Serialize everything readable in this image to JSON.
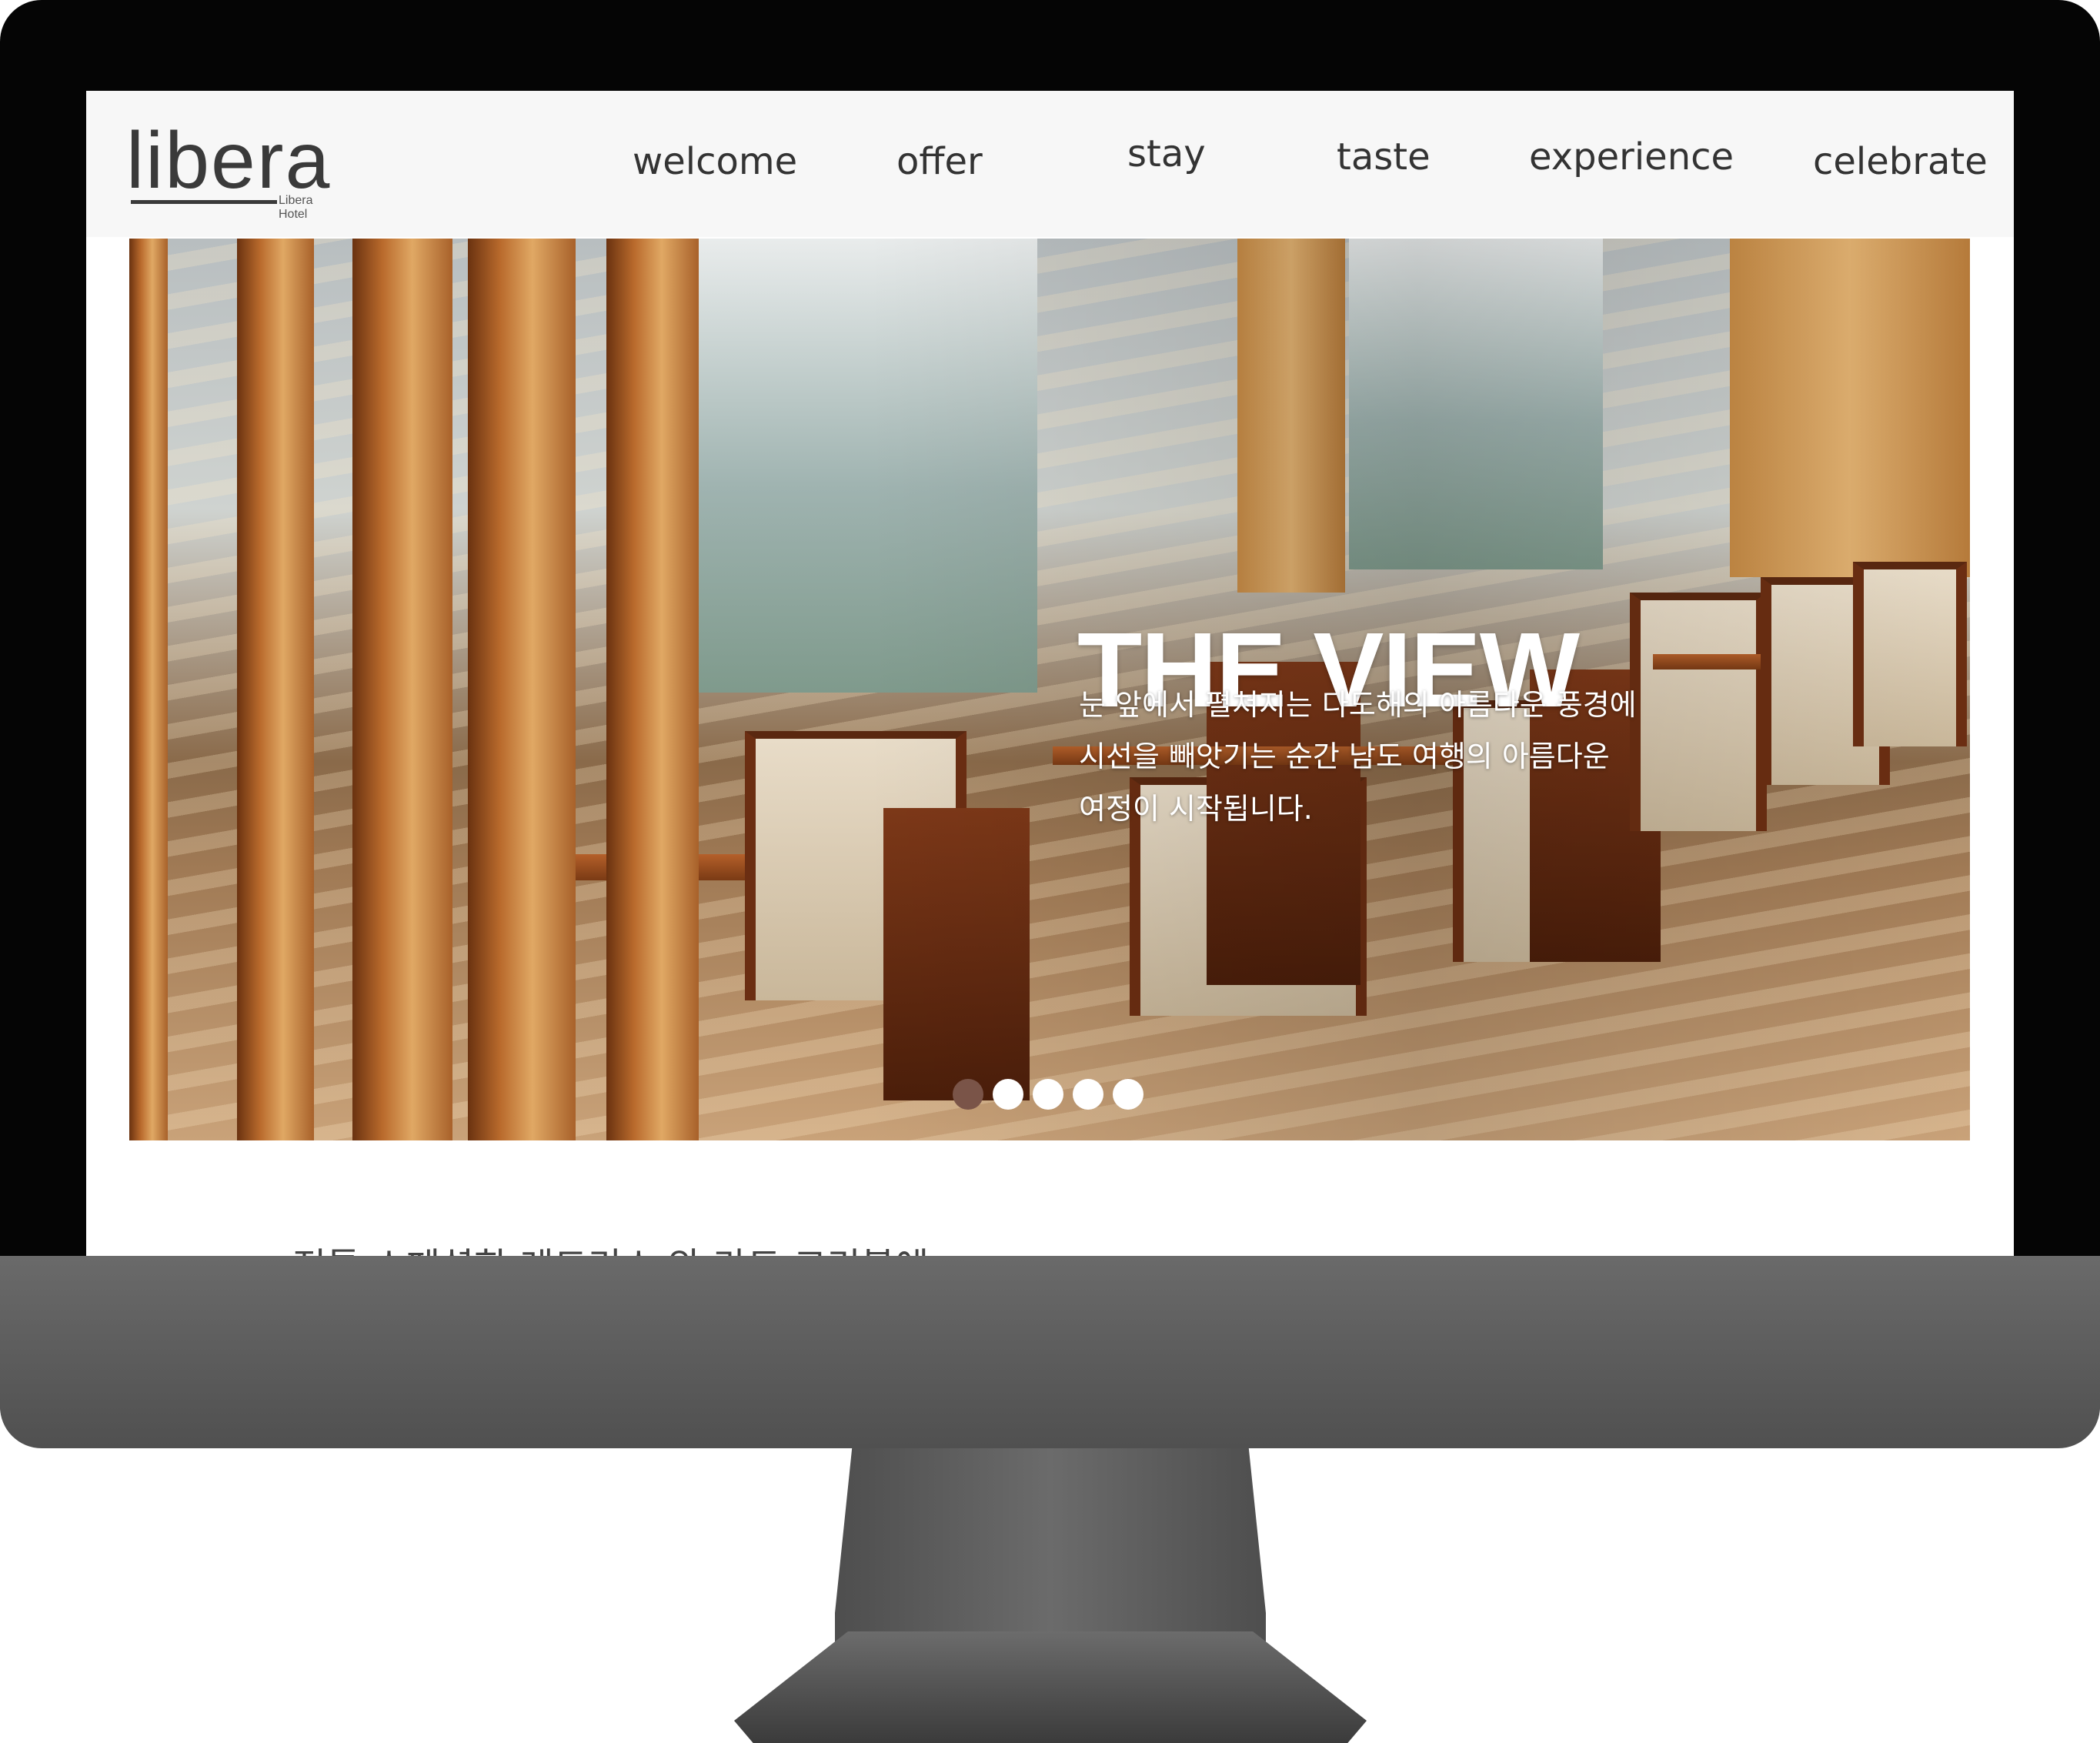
{
  "logo": {
    "wordmark": "libera",
    "subtitle": "Libera Hotel"
  },
  "nav": {
    "items": [
      "welcome",
      "offer",
      "stay",
      "taste",
      "experience",
      "celebrate"
    ]
  },
  "hero": {
    "title": "THE VIEW",
    "lines": [
      "눈 앞에서 펼쳐지는 다도해의 아름다운 풍경에",
      "시선을 빼앗기는 순간 남도 여행의 아름다운",
      "여정이 시작됩니다."
    ],
    "slides": {
      "count": 5,
      "active_index": 0
    }
  },
  "below": {
    "partial_text": "전통 스페셜한 레드리스 와 라도 크리블에"
  },
  "colors": {
    "accent_dot": "#7a5448",
    "frame": "#050505",
    "header_bg": "#f7f7f7"
  }
}
